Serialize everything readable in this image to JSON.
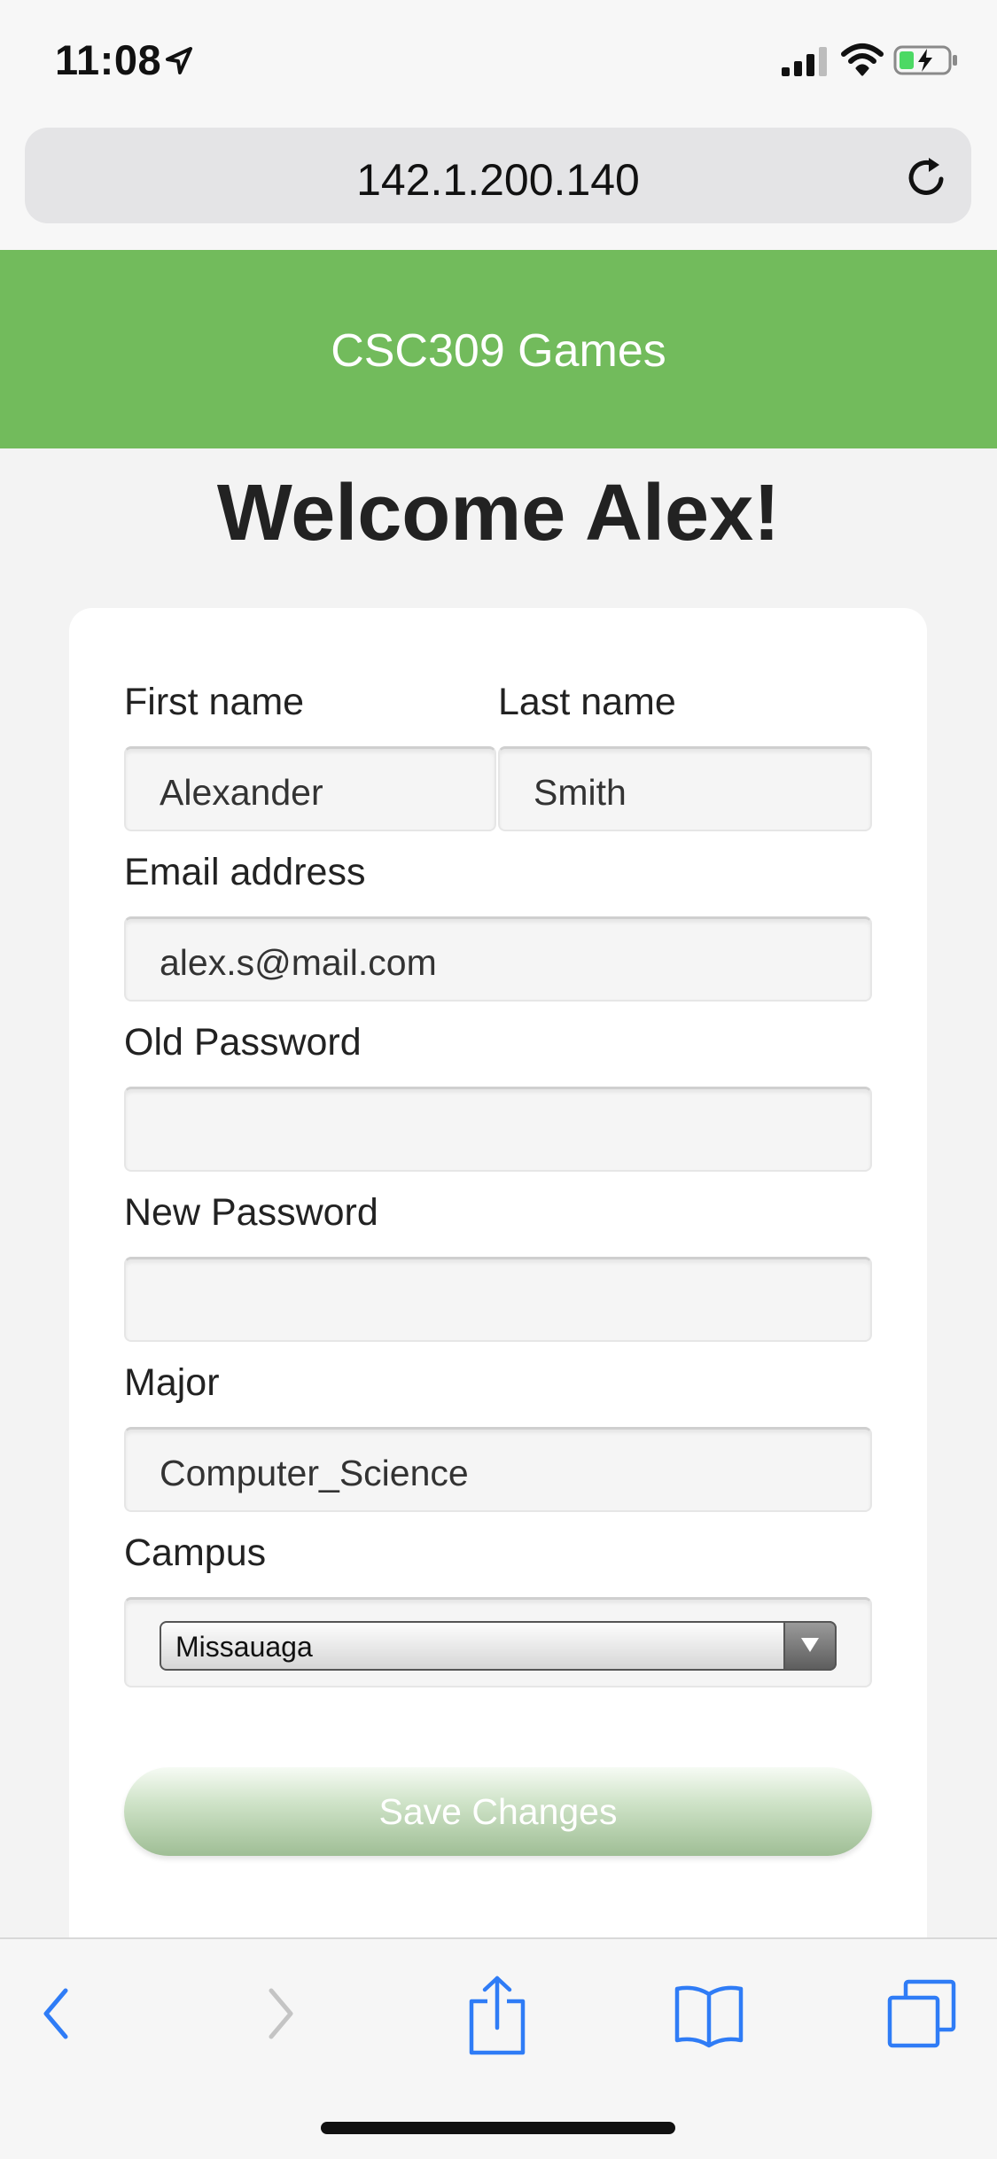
{
  "status_bar": {
    "time": "11:08",
    "icons": [
      "location-arrow-icon",
      "cell-signal-icon",
      "wifi-icon",
      "battery-charging-icon"
    ]
  },
  "browser": {
    "url": "142.1.200.140",
    "reload_icon": "reload-icon"
  },
  "header": {
    "title": "CSC309 Games",
    "color": "#72bb5c"
  },
  "page": {
    "welcome": "Welcome Alex!"
  },
  "form": {
    "first_name_label": "First name",
    "first_name_value": "Alexander",
    "last_name_label": "Last name",
    "last_name_value": "Smith",
    "email_label": "Email address",
    "email_value": "alex.s@mail.com",
    "old_password_label": "Old Password",
    "old_password_value": "",
    "new_password_label": "New Password",
    "new_password_value": "",
    "major_label": "Major",
    "major_value": "Computer_Science",
    "campus_label": "Campus",
    "campus_selected": "Missauaga",
    "save_label": "Save Changes"
  },
  "toolbar": {
    "icons": [
      "back-icon",
      "forward-icon",
      "share-icon",
      "bookmarks-icon",
      "tabs-icon"
    ]
  }
}
